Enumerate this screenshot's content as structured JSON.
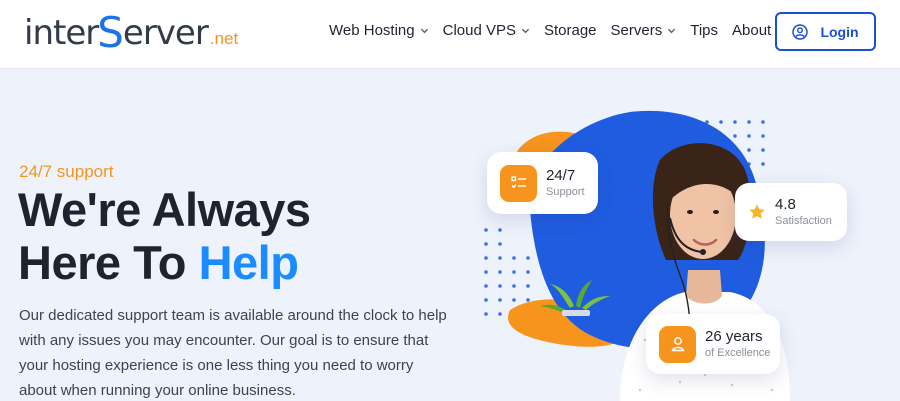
{
  "logo": {
    "part1": "inter",
    "part2": "S",
    "part3": "erver",
    "suffix": ".net"
  },
  "nav": {
    "items": [
      {
        "label": "Web Hosting",
        "dropdown": true
      },
      {
        "label": "Cloud VPS",
        "dropdown": true
      },
      {
        "label": "Storage",
        "dropdown": false
      },
      {
        "label": "Servers",
        "dropdown": true
      },
      {
        "label": "Tips",
        "dropdown": false
      },
      {
        "label": "About Us",
        "dropdown": true
      }
    ],
    "login_label": "Login"
  },
  "hero": {
    "kicker": "24/7 support",
    "headline_line1": "We're Always",
    "headline_line2_prefix": "Here To ",
    "headline_accent": "Help",
    "description": "Our dedicated support team is available around the clock to help with any issues you may encounter. Our goal is to ensure that your hosting experience is one less thing you need to worry about when running your online business."
  },
  "cards": {
    "support": {
      "title": "24/7",
      "subtitle": "Support",
      "icon": "checklist-icon"
    },
    "rating": {
      "title": "4.8",
      "subtitle": "Satisfaction",
      "icon": "star-icon"
    },
    "years": {
      "title": "26 years",
      "subtitle": "of Excellence",
      "icon": "user-icon"
    }
  },
  "colors": {
    "brand_blue": "#1a4fd6",
    "accent_blue": "#1a8cff",
    "orange": "#f7941d",
    "text_dark": "#1e232e",
    "background": "#eef2fb"
  }
}
